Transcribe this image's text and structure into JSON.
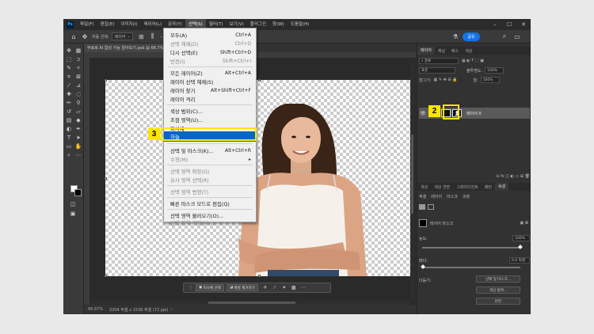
{
  "menubar": {
    "items": [
      "파일(F)",
      "편집(E)",
      "이미지(I)",
      "레이어(L)",
      "문자(Y)",
      "선택(S)",
      "필터(T)",
      "보기(V)",
      "플러그인",
      "창(W)",
      "도움말(H)"
    ],
    "active_index": 5
  },
  "document": {
    "tab_title": "무료로 AI 합성 가능 알아보기.psd @ 66.7%",
    "zoom": "66.67%",
    "info": "2304 픽셀 x 1536 픽셀 (72 ppi)"
  },
  "context_bar": {
    "select_subject": "피사체 선택",
    "remove_background": "배경 제거하기"
  },
  "select_menu": {
    "items": [
      {
        "label": "모두(A)",
        "shortcut": "Ctrl+A",
        "disabled": false
      },
      {
        "label": "선택 해제(D)",
        "shortcut": "Ctrl+D",
        "disabled": true
      },
      {
        "label": "다시 선택(E)",
        "shortcut": "Shift+Ctrl+D",
        "disabled": false
      },
      {
        "label": "반전(I)",
        "shortcut": "Shift+Ctrl+I",
        "disabled": true
      },
      {
        "label": "모든 레이어(Z)",
        "shortcut": "Alt+Ctrl+A",
        "disabled": false
      },
      {
        "label": "레이어 선택 해제(S)",
        "shortcut": "",
        "disabled": false
      },
      {
        "label": "레이어 찾기",
        "shortcut": "Alt+Shift+Ctrl+F",
        "disabled": false
      },
      {
        "label": "레이어 격리",
        "shortcut": "",
        "disabled": false
      },
      {
        "label": "색상 범위(C)...",
        "shortcut": "",
        "disabled": false
      },
      {
        "label": "초점 영역(U)...",
        "shortcut": "",
        "disabled": false
      },
      {
        "label": "피사체",
        "shortcut": "",
        "disabled": false
      },
      {
        "label": "하늘",
        "shortcut": "",
        "disabled": false
      },
      {
        "label": "선택 및 마스크(K)...",
        "shortcut": "Alt+Ctrl+R",
        "disabled": false
      },
      {
        "label": "수정(M)",
        "shortcut": "",
        "disabled": true
      },
      {
        "label": "선택 영역 확장(G)",
        "shortcut": "",
        "disabled": true
      },
      {
        "label": "유사 영역 선택(R)",
        "shortcut": "",
        "disabled": true
      },
      {
        "label": "선택 영역 변형(T)",
        "shortcut": "",
        "disabled": true
      },
      {
        "label": "빠른 마스크 모드로 편집(Q)",
        "shortcut": "",
        "disabled": false
      },
      {
        "label": "선택 영역 불러오기(O)...",
        "shortcut": "",
        "disabled": false
      },
      {
        "label": "선택 영역 저장(V)...",
        "shortcut": "",
        "disabled": true
      }
    ],
    "highlighted_index": 11
  },
  "annotations": {
    "step2": "2",
    "step3": "3"
  },
  "options_bar": {
    "mode": "자동 선택:",
    "target": "레이어",
    "share": "공유"
  },
  "layers_panel": {
    "tabs": [
      "레이어",
      "채널",
      "패스",
      "색상"
    ],
    "filter": "종류",
    "blend_mode": "표준",
    "opacity_label": "불투명도:",
    "opacity": "100%",
    "lock_label": "잠그기:",
    "fill_label": "칠:",
    "fill": "100%",
    "layer_name": "레이어 0"
  },
  "properties_panel": {
    "tabs": [
      "색상",
      "색상 견본",
      "그레이디언트",
      "패턴",
      "속성"
    ],
    "subtabs": [
      "픽셀",
      "레이어",
      "마스크",
      "조정"
    ],
    "section_title": "레이어 마스크",
    "density_label": "농도:",
    "density": "100%",
    "feather_label": "페더:",
    "feather": "0.0 픽셀",
    "refine_label": "다듬기:",
    "btn_select_mask": "선택 및 마스크...",
    "btn_color_range": "색상 범위...",
    "btn_invert": "반전"
  },
  "colors": {
    "accent_yellow": "#ffe400",
    "menu_highlight": "#0a64c8",
    "share_blue": "#1473e6"
  }
}
